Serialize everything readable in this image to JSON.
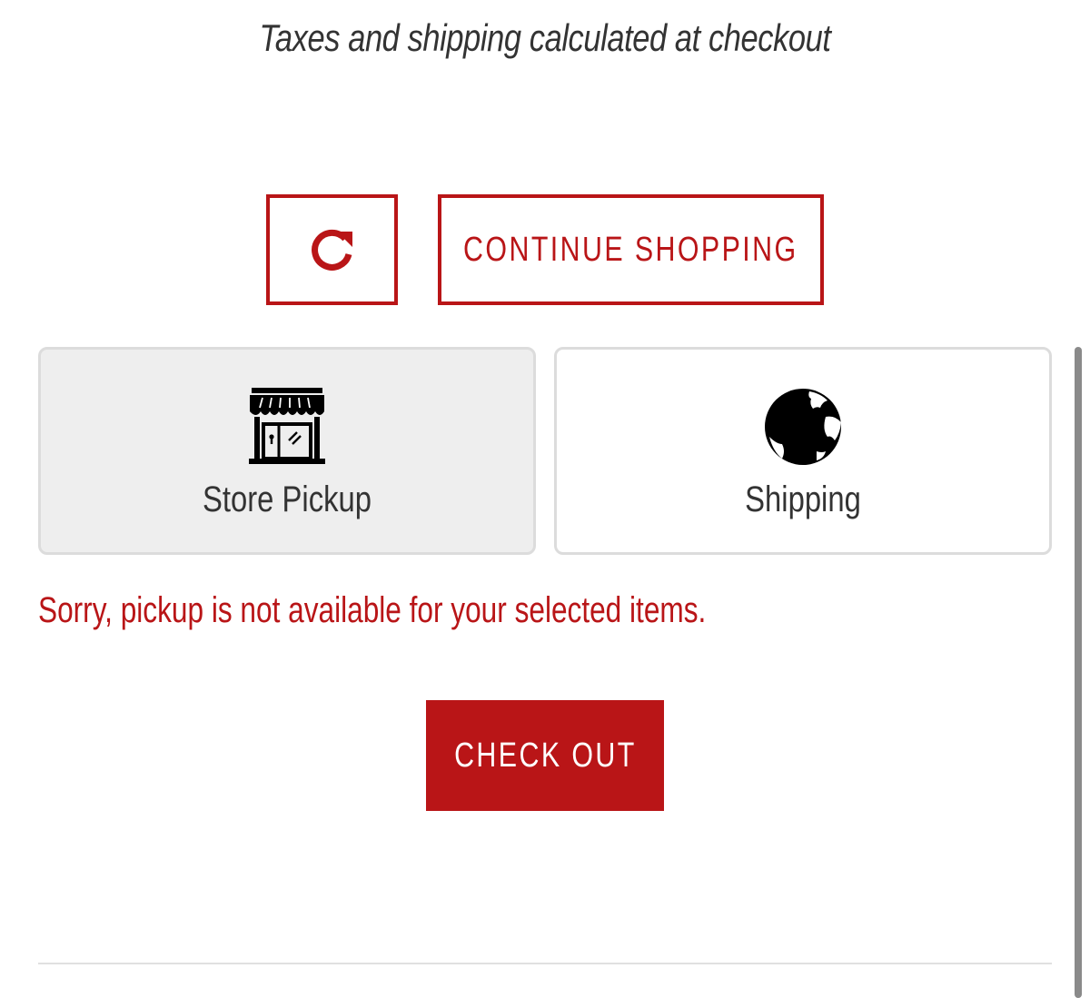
{
  "cart_footer": {
    "tax_note": "Taxes and shipping calculated at checkout",
    "continue_label": "CONTINUE SHOPPING",
    "checkout_label": "CHECK OUT"
  },
  "delivery_options": {
    "items": [
      {
        "label": "Store Pickup",
        "icon": "storefront-icon",
        "selected": true
      },
      {
        "label": "Shipping",
        "icon": "globe-icon",
        "selected": false
      }
    ],
    "error_message": "Sorry, pickup is not available for your selected items."
  },
  "icons": {
    "refresh": "refresh-icon"
  },
  "colors": {
    "accent": "#b91517",
    "selected_card": "#eeeeee",
    "card_border": "#dcdcdc",
    "text": "#333333"
  }
}
